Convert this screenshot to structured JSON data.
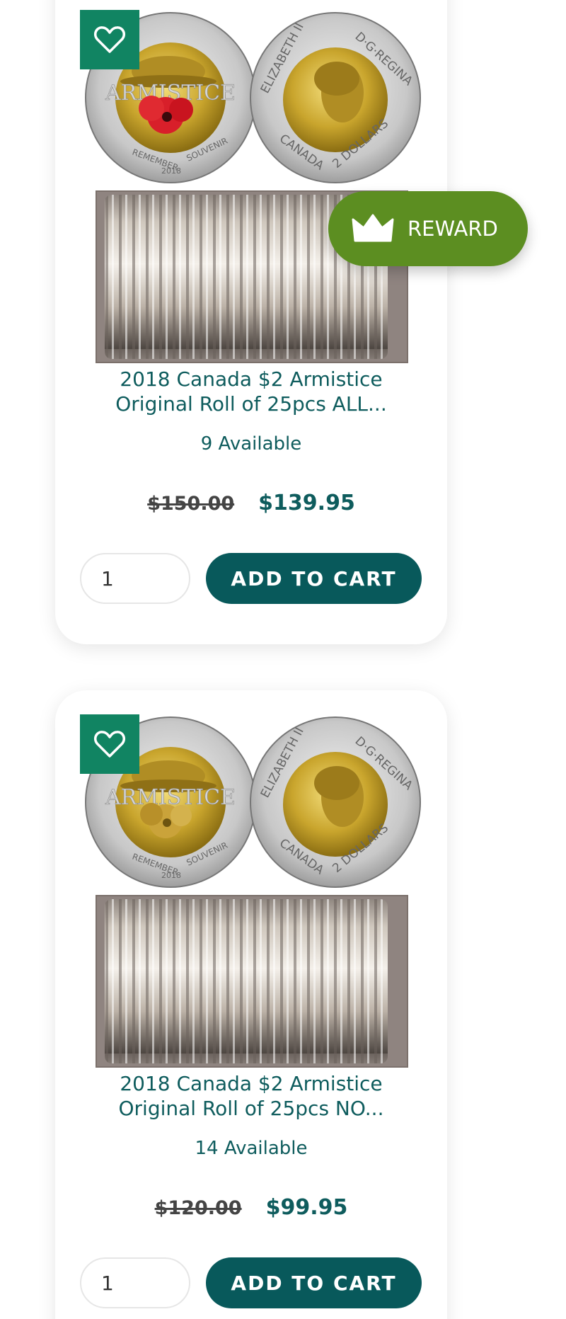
{
  "products": [
    {
      "title": "2018 Canada $2 Armistice Original Roll of 25pcs ALL...",
      "availability": "9 Available",
      "old_price": "$150.00",
      "new_price": "$139.95",
      "quantity": "1",
      "add_to_cart_label": "ADD TO CART",
      "coin_text": {
        "armistice": "ARMISTICE",
        "remember": "REMEMBER",
        "souvenir": "SOUVENIR",
        "year": "2018",
        "elizabeth": "ELIZABETH II",
        "dg_regina": "D·G·REGINA",
        "canada": "CANADA",
        "dollars": "2 DOLLARS"
      }
    },
    {
      "title": "2018 Canada $2 Armistice Original Roll of 25pcs NO...",
      "availability": "14 Available",
      "old_price": "$120.00",
      "new_price": "$99.95",
      "quantity": "1",
      "add_to_cart_label": "ADD TO CART",
      "coin_text": {
        "armistice": "ARMISTICE",
        "remember": "REMEMBER",
        "souvenir": "SOUVENIR",
        "year": "2018",
        "elizabeth": "ELIZABETH II",
        "dg_regina": "D·G·REGINA",
        "canada": "CANADA",
        "dollars": "2 DOLLARS"
      }
    }
  ],
  "reward": {
    "label": "REWARD",
    "icon": "crown-icon"
  },
  "colors": {
    "primary": "#0e5c5d",
    "button": "#08595b",
    "wishlist": "#118462",
    "reward": "#5c8e21",
    "poppy": "#d81f2a"
  }
}
